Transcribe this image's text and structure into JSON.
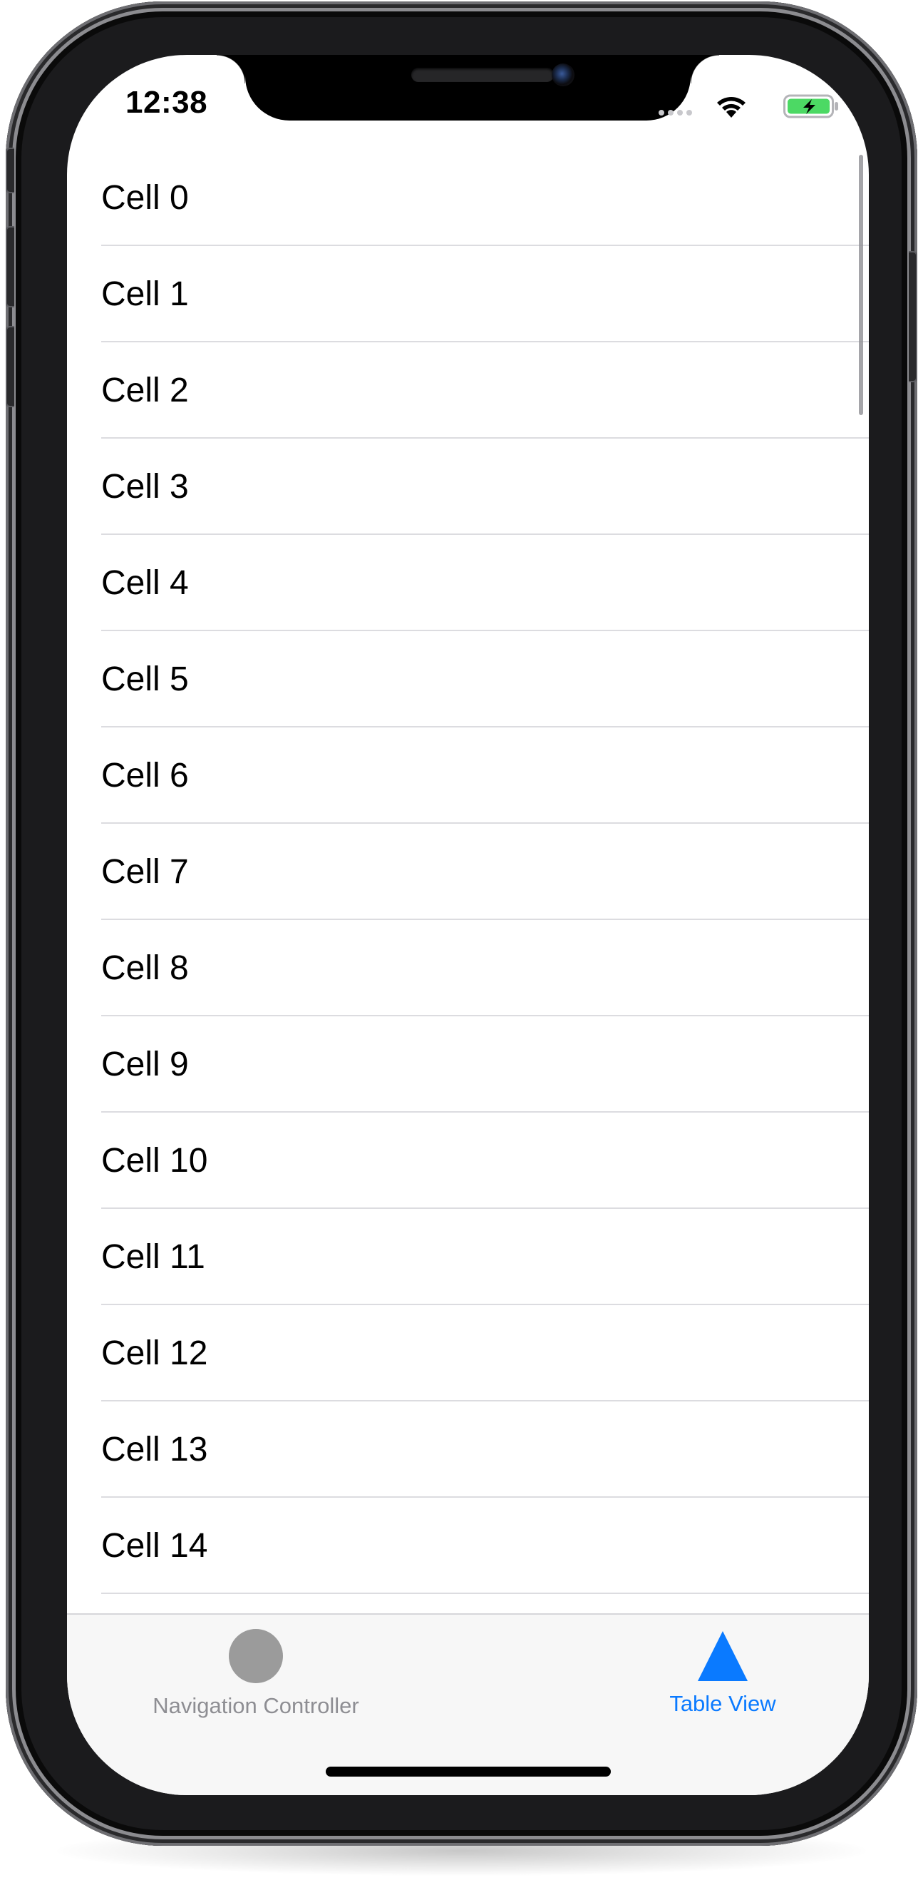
{
  "status_bar": {
    "time": "12:38"
  },
  "cells": [
    "Cell 0",
    "Cell 1",
    "Cell 2",
    "Cell 3",
    "Cell 4",
    "Cell 5",
    "Cell 6",
    "Cell 7",
    "Cell 8",
    "Cell 9",
    "Cell 10",
    "Cell 11",
    "Cell 12",
    "Cell 13",
    "Cell 14"
  ],
  "tab_bar": {
    "tabs": [
      {
        "label": "Navigation Controller",
        "icon": "circle-icon",
        "selected": false
      },
      {
        "label": "Table View",
        "icon": "triangle-icon",
        "selected": true
      }
    ]
  },
  "colors": {
    "accent": "#0a7aff",
    "inactive": "#8e8e93",
    "battery": "#4cd964"
  }
}
